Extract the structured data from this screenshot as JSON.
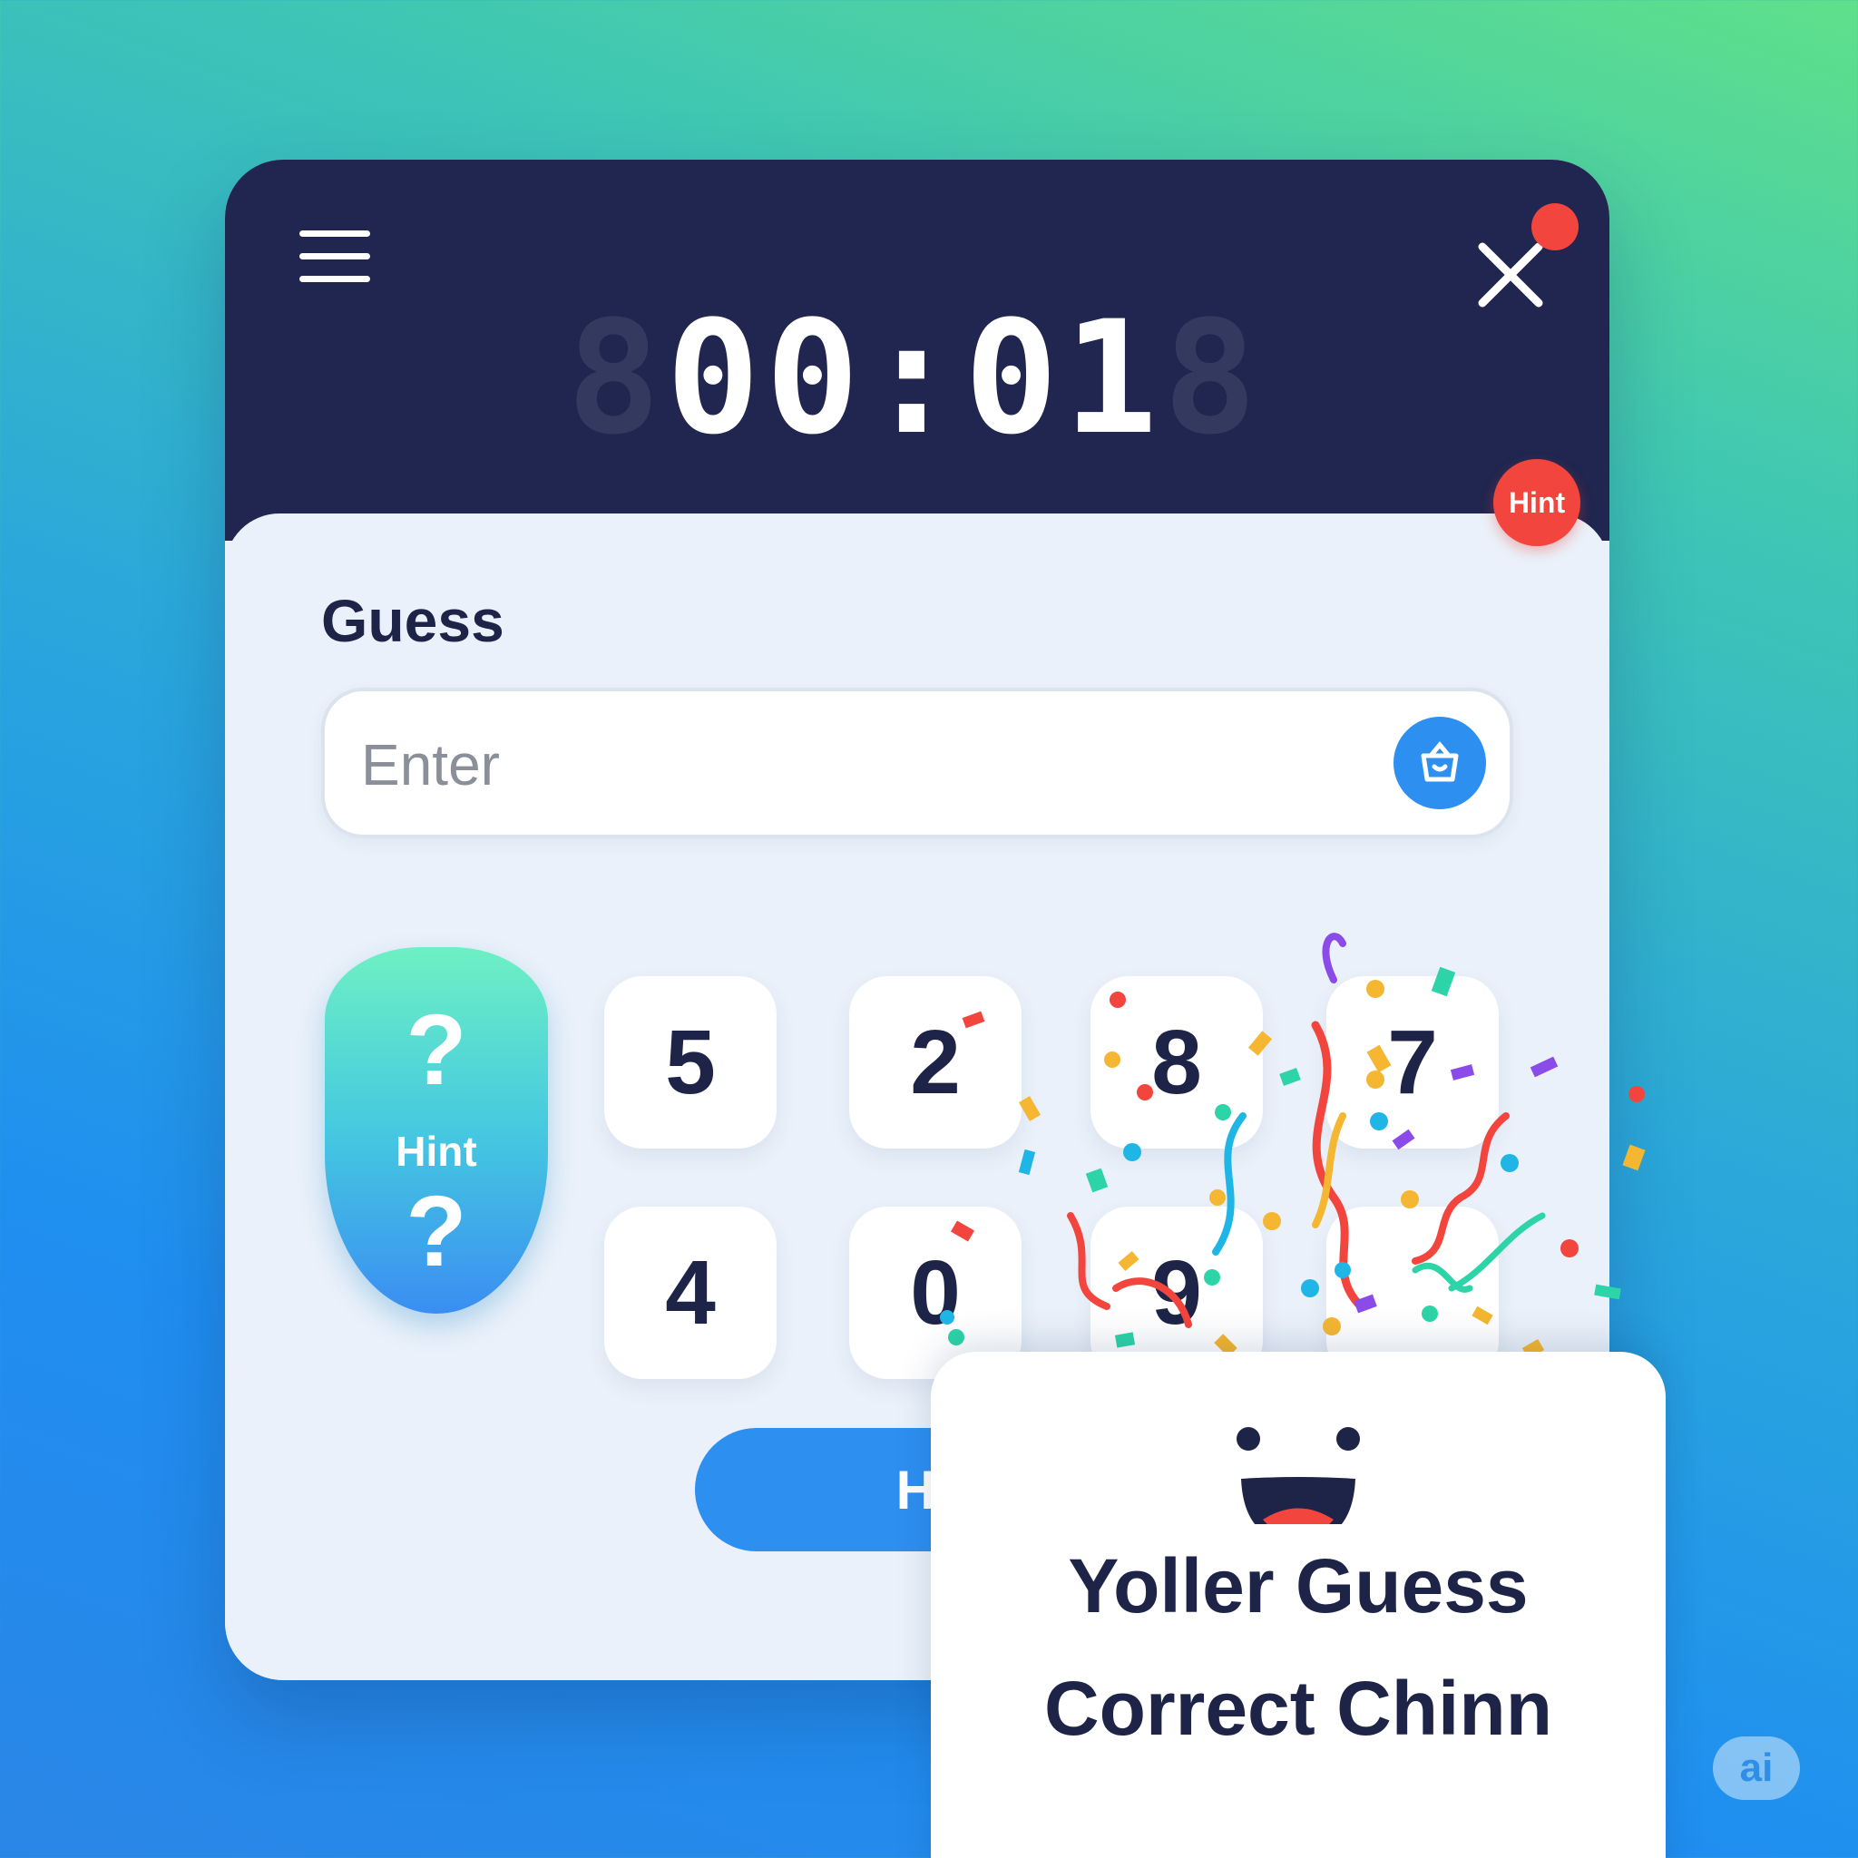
{
  "header": {
    "timer_ghost_left": "8",
    "timer_value": "00:0",
    "timer_partial": "1",
    "timer_ghost_right": "8",
    "menu_icon": "hamburger-menu-icon",
    "close_icon": "close-x-icon"
  },
  "badge": {
    "label": "Hint"
  },
  "guess": {
    "label": "Guess",
    "placeholder": "Enter",
    "submit_icon": "submit-basket-icon"
  },
  "hint_tile": {
    "top_symbol": "?",
    "label": "Hint",
    "bottom_symbol": "?"
  },
  "keypad": {
    "keys": [
      "5",
      "2",
      "8",
      "7",
      "4",
      "0",
      "9",
      ""
    ]
  },
  "hint_button": {
    "label": "Hint"
  },
  "success": {
    "face_icon": "laughing-face-icon",
    "title": "Yoller Guess",
    "subtitle": "Correct Chinn"
  },
  "watermark": {
    "label": "ai"
  },
  "colors": {
    "header": "#20264f",
    "panel": "#eaf1fa",
    "accent_blue": "#2d8ff0",
    "accent_red": "#f2453d",
    "text_dark": "#1e2447"
  }
}
